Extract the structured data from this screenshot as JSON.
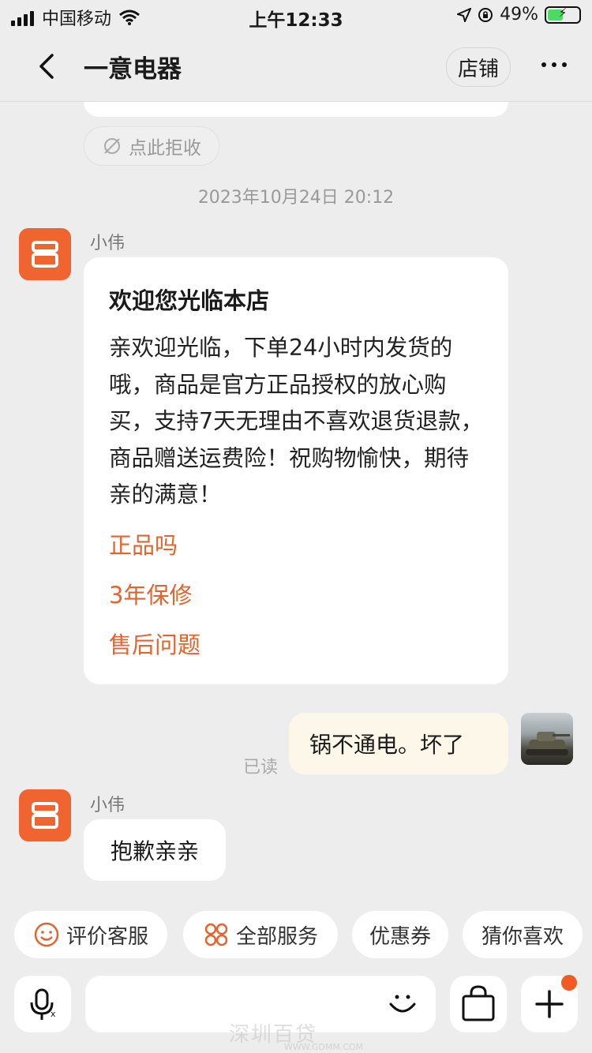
{
  "status_bar": {
    "carrier": "中国移动",
    "time": "上午12:33",
    "battery_text": "49%",
    "battery_level": 0.49
  },
  "nav": {
    "title": "一意电器",
    "shop_label": "店铺"
  },
  "reject_label": "点此拒收",
  "timestamp": "2023年10月24日 20:12",
  "messages": {
    "agent_name": "小伟",
    "welcome_title": "欢迎您光临本店",
    "welcome_body": "亲欢迎光临，下单24小时内发货的哦，商品是官方正品授权的放心购买，支持7天无理由不喜欢退货退款，商品赠送运费险！祝购物愉快，期待亲的满意！",
    "quick_questions": [
      "正品吗",
      "3年保修",
      "售后问题"
    ],
    "my_message": "锅不通电。坏了",
    "read_status": "已读",
    "reply_name": "小伟",
    "reply_text": "抱歉亲亲"
  },
  "chips": {
    "rate": "评价客服",
    "services": "全部服务",
    "coupons": "优惠券",
    "recommend": "猜你喜欢"
  },
  "colors": {
    "accent": "#f0642f",
    "link": "#e5642c",
    "my_bubble": "#fcf7e8",
    "background": "#ededed"
  },
  "watermark": {
    "main": "深圳百贷",
    "sub": "WWW.GDMM.COM"
  }
}
